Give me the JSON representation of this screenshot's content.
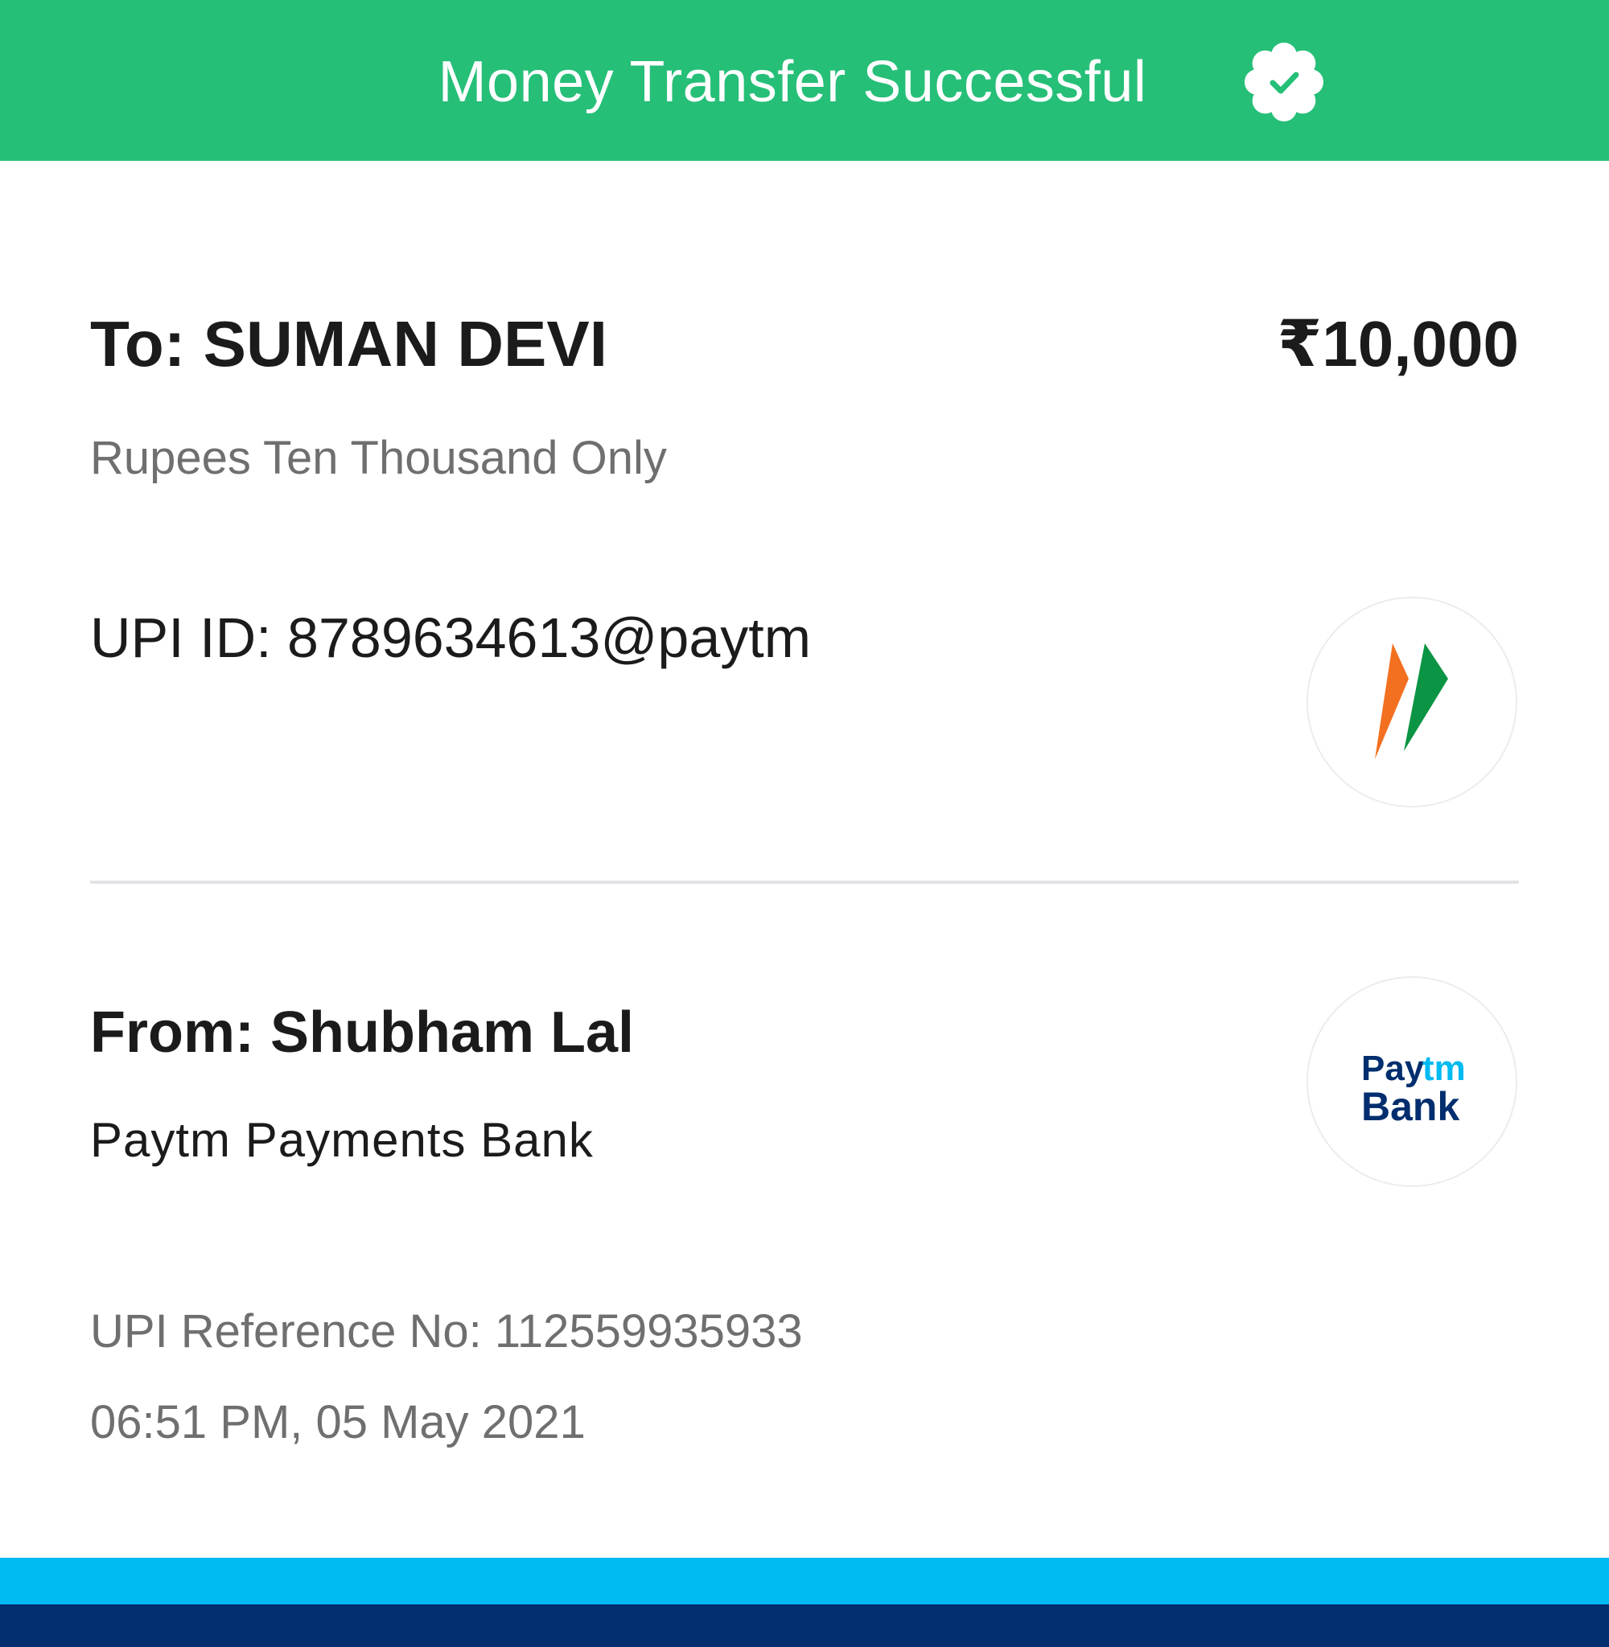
{
  "header": {
    "title": "Money Transfer Successful",
    "badge_icon": "verified-check-icon",
    "background_color": "#26bf78"
  },
  "recipient": {
    "to_text": "To: SUMAN DEVI",
    "amount": "₹10,000",
    "amount_in_words": "Rupees Ten Thousand Only",
    "upi_id_text": "UPI ID: 8789634613@paytm",
    "logo_icon": "upi-logo-icon"
  },
  "sender": {
    "from_text": "From: Shubham Lal",
    "bank_name": "Paytm Payments Bank",
    "bank_logo_icon": "paytm-bank-logo-icon",
    "bank_logo_text": {
      "line1_part1": "Pay",
      "line1_part2": "tm",
      "line2": "Bank"
    }
  },
  "transaction": {
    "reference_text": "UPI Reference No: 112559935933",
    "datetime": "06:51 PM, 05 May 2021"
  },
  "colors": {
    "accent_green": "#26bf78",
    "paytm_light_blue": "#00baf2",
    "paytm_dark_blue": "#002e6e",
    "upi_orange": "#f37021",
    "upi_green": "#0b9444"
  }
}
